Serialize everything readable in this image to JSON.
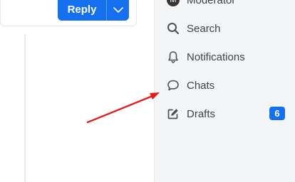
{
  "reply": {
    "label": "Reply"
  },
  "sidebar": {
    "items": [
      {
        "label": "Moderator",
        "icon": "avatar",
        "avatar_initial": "M"
      },
      {
        "label": "Search",
        "icon": "search-icon"
      },
      {
        "label": "Notifications",
        "icon": "bell-icon"
      },
      {
        "label": "Chats",
        "icon": "chat-bubble-icon"
      },
      {
        "label": "Drafts",
        "icon": "pencil-square-icon",
        "badge": "6"
      }
    ]
  },
  "colors": {
    "accent": "#1570ef",
    "sidebar_bg": "#f4f5f7",
    "annotation_arrow": "#e11d1d"
  }
}
